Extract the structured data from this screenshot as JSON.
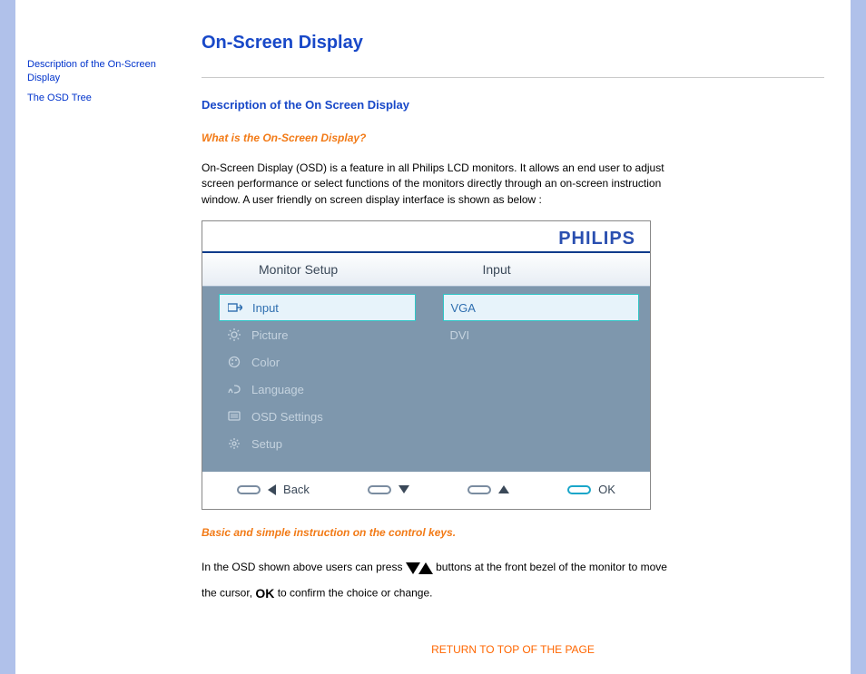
{
  "sidebar": {
    "items": [
      {
        "label": "Description of the On-Screen Display"
      },
      {
        "label": "The OSD Tree"
      }
    ]
  },
  "main": {
    "title": "On-Screen Display",
    "section_title": "Description of the On Screen Display",
    "question": "What is the On-Screen Display?",
    "paragraph1": "On-Screen Display (OSD) is a feature in all Philips LCD monitors. It allows an end user to adjust screen performance or select functions of the monitors directly through an on-screen instruction window. A user friendly on screen display interface is shown as below :",
    "instruction_heading": "Basic and simple instruction on the control keys.",
    "paragraph2a": "In the OSD shown above users can press ",
    "paragraph2b": " buttons at the front bezel of the monitor to move the cursor, ",
    "ok_glyph": "OK",
    "paragraph2c": " to confirm the choice or change.",
    "return_link": "RETURN TO TOP OF THE PAGE"
  },
  "osd": {
    "brand": "PHILIPS",
    "tab_left": "Monitor Setup",
    "tab_right": "Input",
    "menu": [
      {
        "label": "Input",
        "selected": true
      },
      {
        "label": "Picture",
        "selected": false
      },
      {
        "label": "Color",
        "selected": false
      },
      {
        "label": "Language",
        "selected": false
      },
      {
        "label": "OSD Settings",
        "selected": false
      },
      {
        "label": "Setup",
        "selected": false
      }
    ],
    "submenu": [
      {
        "label": "VGA",
        "selected": true
      },
      {
        "label": "DVI",
        "selected": false
      }
    ],
    "nav": {
      "back": "Back",
      "ok": "OK"
    }
  }
}
